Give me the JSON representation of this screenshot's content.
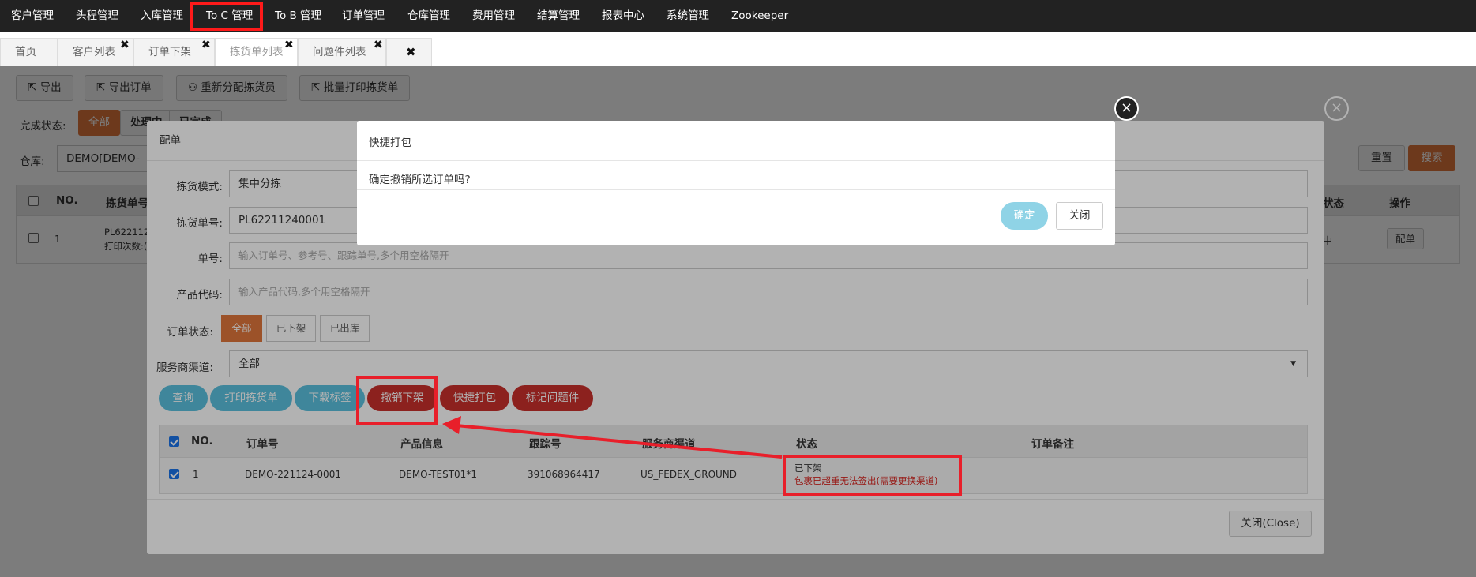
{
  "topnav": {
    "items": [
      "客户管理",
      "头程管理",
      "入库管理",
      "To C 管理",
      "To B 管理",
      "订单管理",
      "仓库管理",
      "费用管理",
      "结算管理",
      "报表中心",
      "系统管理",
      "Zookeeper"
    ]
  },
  "tabs": [
    {
      "label": "首页"
    },
    {
      "label": "客户列表"
    },
    {
      "label": "订单下架"
    },
    {
      "label": "拣货单列表"
    },
    {
      "label": "问题件列表"
    }
  ],
  "toolbar": {
    "export": "导出",
    "export_order": "导出订单",
    "reassign": "重新分配拣货员",
    "batch_print": "批量打印拣货单"
  },
  "filters": {
    "status_label": "完成状态:",
    "status_all": "全部",
    "status_processing": "处理中",
    "status_done": "已完成",
    "warehouse_label": "仓库:",
    "warehouse_value": "DEMO[DEMO-",
    "reset": "重置",
    "search": "搜索"
  },
  "bg_table": {
    "headers": {
      "no": "NO.",
      "pick_no": "拣货单号",
      "status": "状态",
      "ops": "操作"
    },
    "row": {
      "no": "1",
      "pick_no": "PL622112",
      "print_count": "打印次数:(",
      "status": "中",
      "action": "配单"
    }
  },
  "modal": {
    "title": "配单",
    "pick_mode_label": "拣货模式:",
    "pick_mode_value": "集中分拣",
    "pick_no_label": "拣货单号:",
    "pick_no_value": "PL62211240001",
    "order_no_label": "单号:",
    "order_no_placeholder": "输入订单号、参考号、跟踪单号,多个用空格隔开",
    "product_label": "产品代码:",
    "product_placeholder": "输入产品代码,多个用空格隔开",
    "order_status_label": "订单状态:",
    "order_status_options": [
      "全部",
      "已下架",
      "已出库"
    ],
    "channel_label": "服务商渠道:",
    "channel_value": "全部",
    "buttons": {
      "query": "查询",
      "print_pick": "打印拣货单",
      "download_label": "下载标签",
      "cancel_shelve": "撤销下架",
      "quick_pack": "快捷打包",
      "mark_problem": "标记问题件"
    },
    "table": {
      "headers": [
        "NO.",
        "订单号",
        "产品信息",
        "跟踪号",
        "服务商渠道",
        "状态",
        "订单备注"
      ],
      "rows": [
        {
          "no": "1",
          "order_no": "DEMO-221124-0001",
          "product": "DEMO-TEST01*1",
          "tracking": "391068964417",
          "channel": "US_FEDEX_GROUND",
          "status": "已下架",
          "status_error": "包裹已超重无法签出(需要更换渠道)",
          "remark": ""
        }
      ]
    },
    "close_button": "关闭(Close)"
  },
  "dialog": {
    "title": "快捷打包",
    "message": "确定撤销所选订单吗?",
    "confirm": "确定",
    "close": "关闭"
  },
  "colors": {
    "nav_bg": "#222222",
    "accent_orange": "#e0763c",
    "teal": "#5bc0de",
    "dark_red": "#c9302c",
    "annotation_red": "#e81f2a"
  }
}
